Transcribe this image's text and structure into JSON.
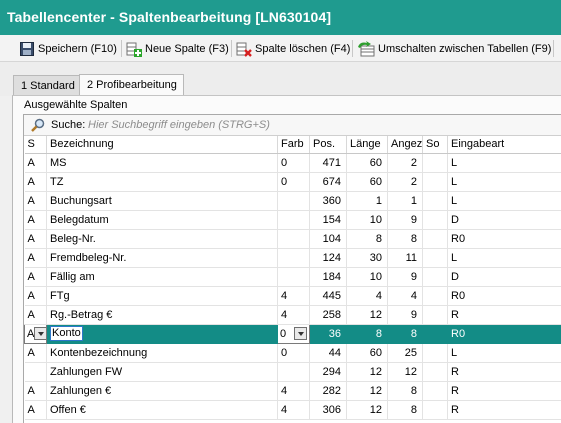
{
  "window": {
    "title": "Tabellencenter - Spaltenbearbeitung [LN630104]"
  },
  "toolbar": {
    "buttons": [
      {
        "key": "save",
        "label": "Speichern (F10)",
        "icon": "save-icon"
      },
      {
        "key": "add",
        "label": "Neue Spalte (F3)",
        "icon": "add-column-icon"
      },
      {
        "key": "delete",
        "label": "Spalte löschen (F4)",
        "icon": "delete-column-icon"
      },
      {
        "key": "switch",
        "label": "Umschalten zwischen Tabellen (F9)",
        "icon": "switch-tables-icon"
      }
    ]
  },
  "tabs": [
    {
      "label": "1 Standard",
      "active": false
    },
    {
      "label": "2 Profibearbeitung",
      "active": true
    }
  ],
  "section": {
    "label": "Ausgewählte Spalten"
  },
  "search": {
    "label": "Suche:",
    "placeholder": "Hier Suchbegriff eingeben (STRG+S)",
    "icon": "search-icon"
  },
  "grid": {
    "columns": [
      "S",
      "Bezeichnung",
      "Farb",
      "Pos.",
      "Länge",
      "Angez",
      "So",
      "Eingabeart"
    ],
    "selected_row": 9,
    "rows": [
      {
        "s": "A",
        "name": "MS",
        "farb": "0",
        "pos": "471",
        "len": "60",
        "angez": "2",
        "so": "",
        "art": "L"
      },
      {
        "s": "A",
        "name": "TZ",
        "farb": "0",
        "pos": "674",
        "len": "60",
        "angez": "2",
        "so": "",
        "art": "L"
      },
      {
        "s": "A",
        "name": "Buchungsart",
        "farb": "",
        "pos": "360",
        "len": "1",
        "angez": "1",
        "so": "",
        "art": "L"
      },
      {
        "s": "A",
        "name": "Belegdatum",
        "farb": "",
        "pos": "154",
        "len": "10",
        "angez": "9",
        "so": "",
        "art": "D"
      },
      {
        "s": "A",
        "name": "Beleg-Nr.",
        "farb": "",
        "pos": "104",
        "len": "8",
        "angez": "8",
        "so": "",
        "art": "R0"
      },
      {
        "s": "A",
        "name": "Fremdbeleg-Nr.",
        "farb": "",
        "pos": "124",
        "len": "30",
        "angez": "11",
        "so": "",
        "art": "L"
      },
      {
        "s": "A",
        "name": "Fällig am",
        "farb": "",
        "pos": "184",
        "len": "10",
        "angez": "9",
        "so": "",
        "art": "D"
      },
      {
        "s": "A",
        "name": "FTg",
        "farb": "4",
        "pos": "445",
        "len": "4",
        "angez": "4",
        "so": "",
        "art": "R0"
      },
      {
        "s": "A",
        "name": "Rg.-Betrag €",
        "farb": "4",
        "pos": "258",
        "len": "12",
        "angez": "9",
        "so": "",
        "art": "R"
      },
      {
        "s": "A",
        "name": "Konto",
        "farb": "0",
        "pos": "36",
        "len": "8",
        "angez": "8",
        "so": "",
        "art": "R0"
      },
      {
        "s": "A",
        "name": "Kontenbezeichnung",
        "farb": "0",
        "pos": "44",
        "len": "60",
        "angez": "25",
        "so": "",
        "art": "L"
      },
      {
        "s": "",
        "name": "Zahlungen FW",
        "farb": "",
        "pos": "294",
        "len": "12",
        "angez": "12",
        "so": "",
        "art": "R"
      },
      {
        "s": "A",
        "name": "Zahlungen €",
        "farb": "4",
        "pos": "282",
        "len": "12",
        "angez": "8",
        "so": "",
        "art": "R"
      },
      {
        "s": "A",
        "name": "Offen €",
        "farb": "4",
        "pos": "306",
        "len": "12",
        "angez": "8",
        "so": "",
        "art": "R"
      }
    ]
  },
  "colors": {
    "titlebar": "#1f9b8f",
    "selection": "#138c86"
  }
}
